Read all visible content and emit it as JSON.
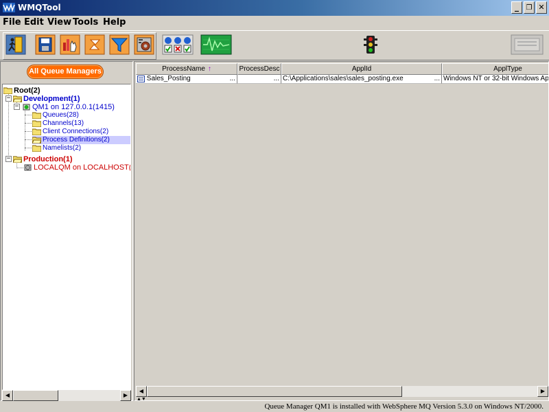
{
  "window": {
    "title": "WMQTool",
    "controls": {
      "minimize": "_",
      "restore": "❐",
      "close": "✕"
    }
  },
  "menu": [
    "File",
    "Edit",
    "View",
    "Tools",
    "Help"
  ],
  "toolbar": {
    "icons": [
      "exit-icon",
      "save-icon",
      "hand-chart-icon",
      "refresh-icon",
      "filter-icon",
      "settings-chip-icon",
      "status-lights-icon",
      "monitor-wave-icon",
      "traffic-light-icon",
      "disabled-panel-icon"
    ]
  },
  "left_panel": {
    "queue_managers_button": "All Queue Managers",
    "tree": {
      "root": "Root(2)",
      "development": "Development(1)",
      "qm1": "QM1  on 127.0.0.1(1415)",
      "queues": "Queues(28)",
      "channels": "Channels(13)",
      "client_connections": "Client Connections(2)",
      "process_definitions": "Process Definitions(2)",
      "namelists": "Namelists(2)",
      "production": "Production(1)",
      "localqm": "LOCALQM on LOCALHOST("
    },
    "colors": {
      "development": "#0000cc",
      "production": "#cc0000",
      "selected": "#ccccff"
    }
  },
  "table": {
    "columns": [
      "ProcessName",
      "ProcessDesc",
      "ApplId",
      "ApplType"
    ],
    "sort_indicator": "↑",
    "rows": [
      {
        "ProcessName": "Sales_Posting",
        "ProcessDesc": "",
        "ApplId": "C:\\Applications\\sales\\sales_posting.exe",
        "ApplType": "Windows NT or 32-bit Windows Ap",
        "ellipsis": "..."
      }
    ]
  },
  "status": "Queue Manager QM1  is installed with WebSphere MQ Version 5.3.0 on Windows NT/2000."
}
